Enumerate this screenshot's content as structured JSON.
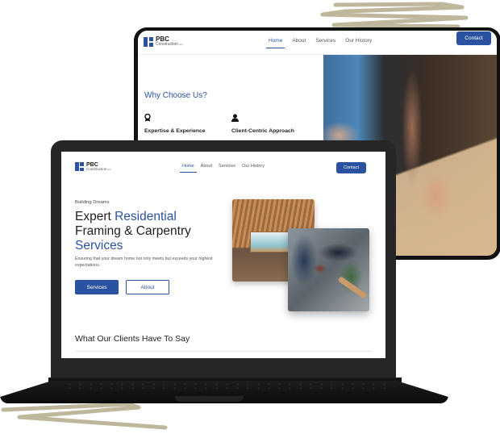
{
  "tablet": {
    "logo": {
      "name": "PBC",
      "subtitle": "Construction",
      "suffix": "Inc"
    },
    "nav": {
      "links": [
        {
          "label": "Home",
          "active": true
        },
        {
          "label": "About",
          "active": false
        },
        {
          "label": "Services",
          "active": false
        },
        {
          "label": "Our History",
          "active": false
        }
      ],
      "contact_label": "Contact"
    },
    "section_title": "Why Choose Us?",
    "features": [
      {
        "icon": "award-icon",
        "label": "Expertise & Experience"
      },
      {
        "icon": "user-icon",
        "label": "Client-Centric Approach"
      }
    ]
  },
  "laptop": {
    "logo": {
      "name": "PBC",
      "subtitle": "Construction",
      "suffix": "Inc"
    },
    "nav": {
      "links": [
        {
          "label": "Home",
          "active": true
        },
        {
          "label": "About",
          "active": false
        },
        {
          "label": "Services",
          "active": false
        },
        {
          "label": "Our History",
          "active": false
        }
      ],
      "contact_label": "Contact"
    },
    "hero": {
      "eyebrow": "Building Dreams",
      "title_part1": "Expert ",
      "title_accent1": "Residential",
      "title_part2": "Framing & Carpentry",
      "title_accent2": "Services",
      "description": "Ensuring that your dream home not only meets but exceeds your highest expectations.",
      "primary_button": "Services",
      "secondary_button": "About"
    },
    "testimonials_title": "What Our Clients Have To Say"
  },
  "colors": {
    "brand_blue": "#2a52a0",
    "scribble": "#bdb89c",
    "device_frame": "#262626"
  }
}
